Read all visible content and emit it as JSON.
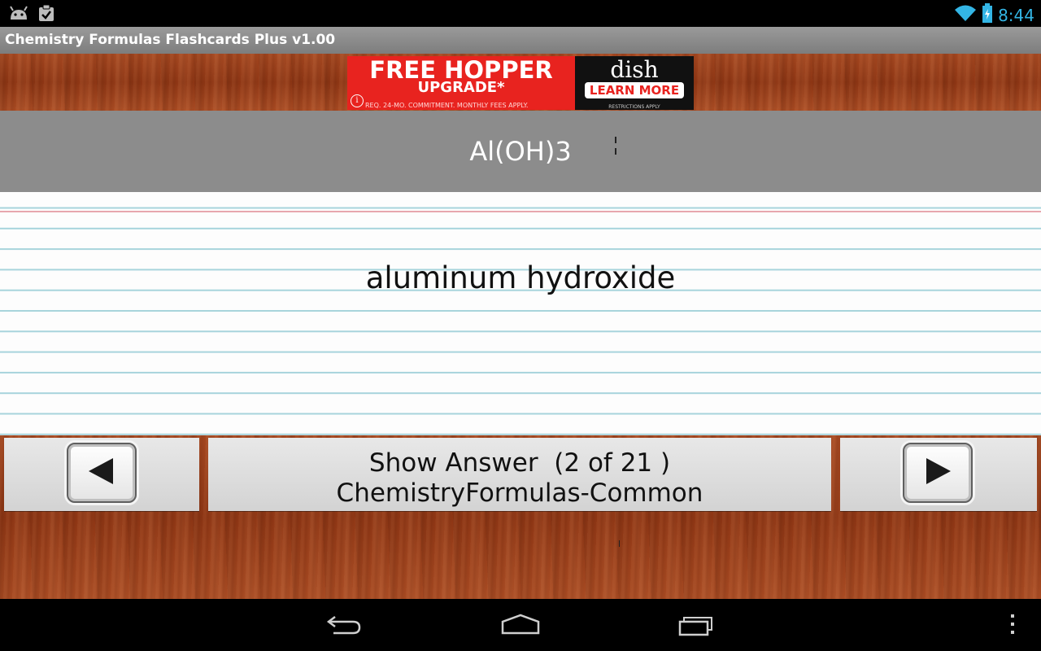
{
  "status_bar": {
    "time": "8:44",
    "icons": [
      "android-debug-icon",
      "clipboard-check-icon",
      "wifi-icon",
      "battery-icon"
    ],
    "accent_color": "#33b5e5"
  },
  "app": {
    "title": "Chemistry Formulas Flashcards Plus v1.00"
  },
  "ad": {
    "headline": "FREE HOPPER",
    "subheadline": "UPGRADE*",
    "fine_print": "REQ. 24-MO. COMMITMENT. MONTHLY FEES APPLY.",
    "brand": "dish",
    "cta": "LEARN MORE",
    "restrictions": "RESTRICTIONS APPLY",
    "info_label": "i",
    "colors": {
      "left": "#e8231f",
      "right": "#111111"
    }
  },
  "flashcard": {
    "question": "Al(OH)3",
    "answer": "aluminum hydroxide"
  },
  "controls": {
    "show_answer_label": "Show Answer  (2 of 21 )",
    "deck_name": "ChemistryFormulas-Common",
    "prev_icon": "left-arrow-icon",
    "next_icon": "right-arrow-icon"
  },
  "system_nav": {
    "icons": [
      "back-icon",
      "home-icon",
      "recents-icon",
      "overflow-menu-icon"
    ]
  }
}
